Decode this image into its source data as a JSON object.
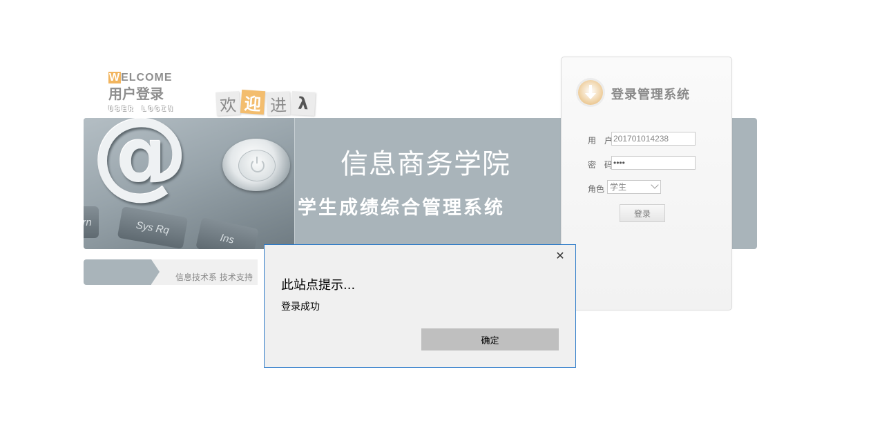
{
  "header": {
    "welcome_initial": "W",
    "welcome_rest": "ELCOME",
    "title_cn": "用户登录",
    "title_en": "USER LOGIN",
    "tiles": [
      "欢",
      "迎",
      "进",
      "λ"
    ]
  },
  "banner": {
    "title": "信息商务学院",
    "subtitle": "学生成绩综合管理系统",
    "keys": [
      "Sys Rq",
      "Ins",
      "rn"
    ]
  },
  "footer": {
    "support_text": "信息技术系 技术支持"
  },
  "login": {
    "title": "登录管理系统",
    "user_label": "用 户",
    "user_value": "201701014238",
    "password_label": "密 码",
    "password_value": "••••",
    "role_label": "角色",
    "role_value": "学生",
    "submit_label": "登录"
  },
  "dialog": {
    "close_glyph": "✕",
    "title": "此站点提示...",
    "message": "登录成功",
    "ok_label": "确定"
  },
  "colors": {
    "banner": "#a9b4ba",
    "accent_orange": "#f2b55e",
    "dialog_border": "#2a79c8",
    "dialog_button": "#bfbfbf"
  }
}
